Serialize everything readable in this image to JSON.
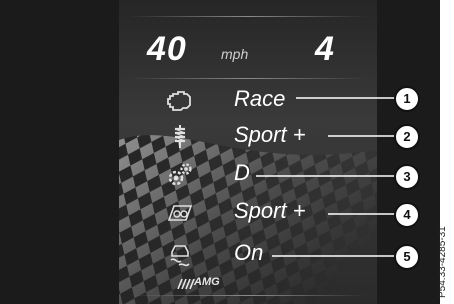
{
  "speed": {
    "value": "40",
    "unit": "mph"
  },
  "gear": "4",
  "rows": [
    {
      "icon": "engine-icon",
      "label": "Race",
      "callout": "1"
    },
    {
      "icon": "suspension-spring-icon",
      "label": "Sport +",
      "callout": "2"
    },
    {
      "icon": "transmission-gears-icon",
      "label": "D",
      "callout": "3"
    },
    {
      "icon": "chassis-icon",
      "label": "Sport +",
      "callout": "4"
    },
    {
      "icon": "esp-skid-icon",
      "label": "On",
      "callout": "5"
    }
  ],
  "logo": "AMG",
  "reference_code": "P54.33-4285-31",
  "colors": {
    "background": "#1b1b1b",
    "panel": "#333333",
    "text": "#ffffff",
    "callout": "#ffffff"
  }
}
